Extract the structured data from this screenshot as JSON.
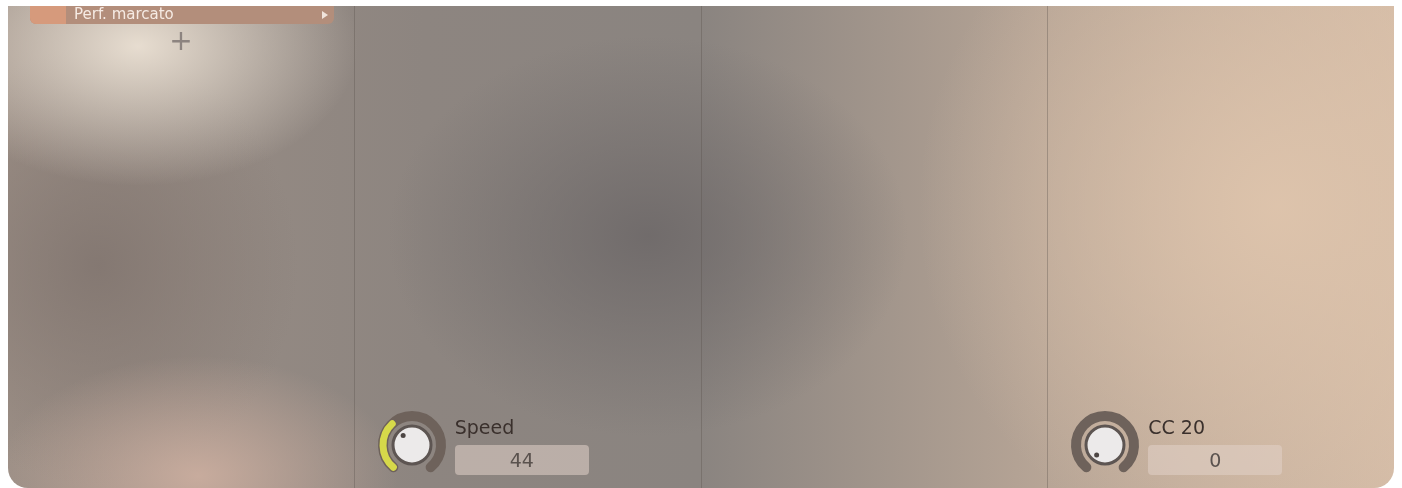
{
  "columns": [
    {
      "kind": "articulations",
      "articulation": {
        "label": "Perf. marcato"
      },
      "add_label": "+"
    },
    {
      "kind": "knob",
      "knob": {
        "label": "Speed",
        "value": "44"
      }
    },
    {
      "kind": "empty"
    },
    {
      "kind": "knob",
      "knob": {
        "label": "CC 20",
        "value": "0"
      }
    }
  ]
}
